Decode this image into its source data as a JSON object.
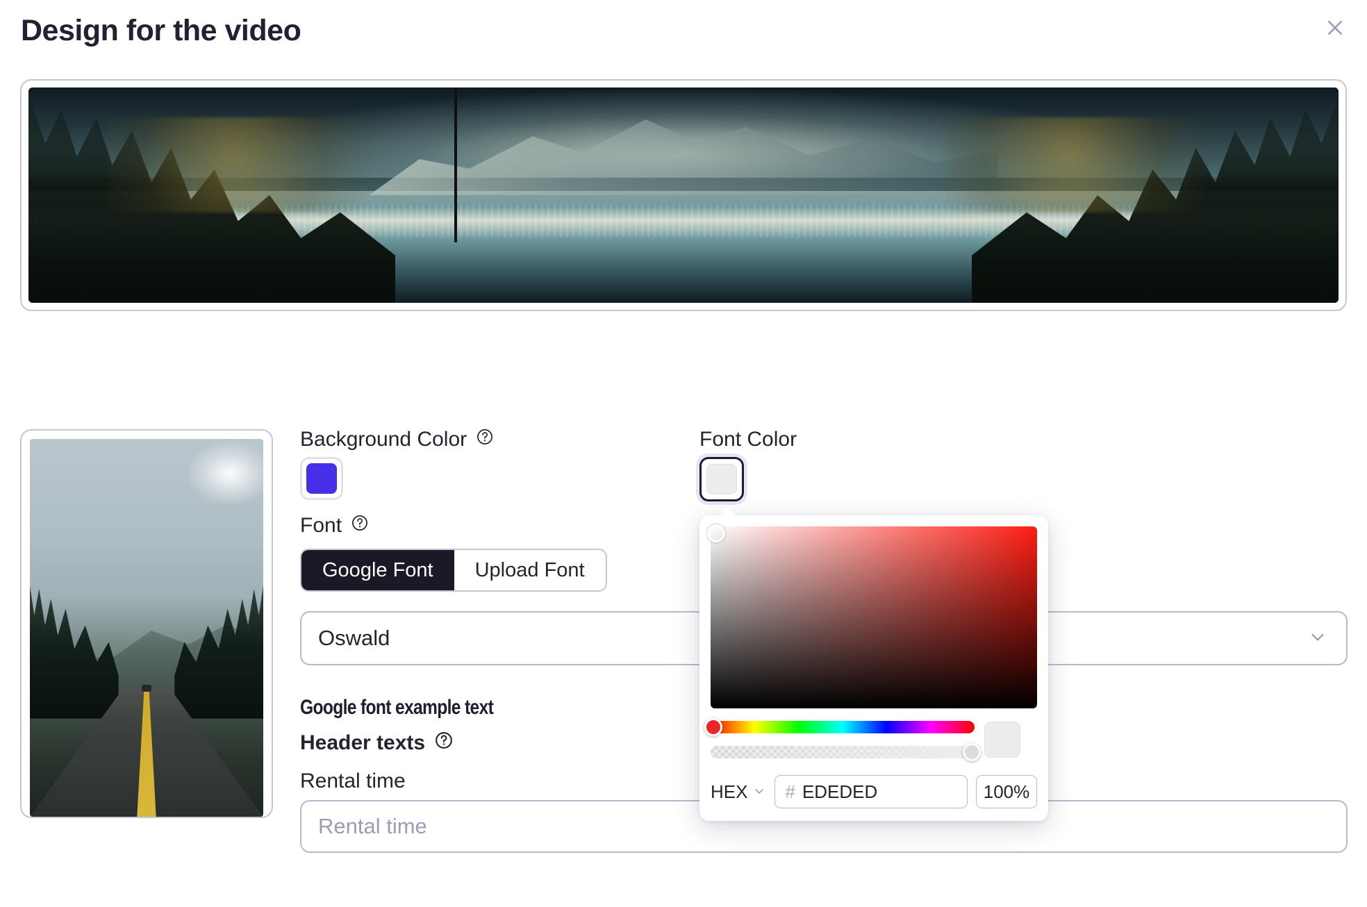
{
  "header": {
    "title": "Design for the video",
    "close_icon": "close-icon"
  },
  "banner": {
    "alt": "mountain lake reflection landscape"
  },
  "preview": {
    "alt": "forest road portrait preview"
  },
  "form": {
    "background_color": {
      "label": "Background Color",
      "help_icon": "question-circle-icon",
      "value": "#4530E8"
    },
    "font_color": {
      "label": "Font Color",
      "help_icon": "question-circle-icon",
      "value": "#EDEDED"
    },
    "font": {
      "label": "Font",
      "help_icon": "question-circle-icon",
      "tabs": [
        {
          "label": "Google Font",
          "active": true
        },
        {
          "label": "Upload Font",
          "active": false
        }
      ],
      "selected_font": "Oswald",
      "chevron_icon": "chevron-down-icon",
      "example_text": "Google font example text"
    },
    "header_texts": {
      "label": "Header texts",
      "help_icon": "question-circle-icon",
      "fields": [
        {
          "label": "Rental time",
          "placeholder": "Rental time",
          "value": ""
        }
      ]
    }
  },
  "color_picker": {
    "hue_thumb_color": "#EC2525",
    "saturation_cursor": "top-left",
    "mode": "HEX",
    "mode_chevron_icon": "chevron-down-icon",
    "hash_symbol": "#",
    "hex_value": "EDEDED",
    "opacity": "100%",
    "preview_color": "#EDEDED"
  }
}
